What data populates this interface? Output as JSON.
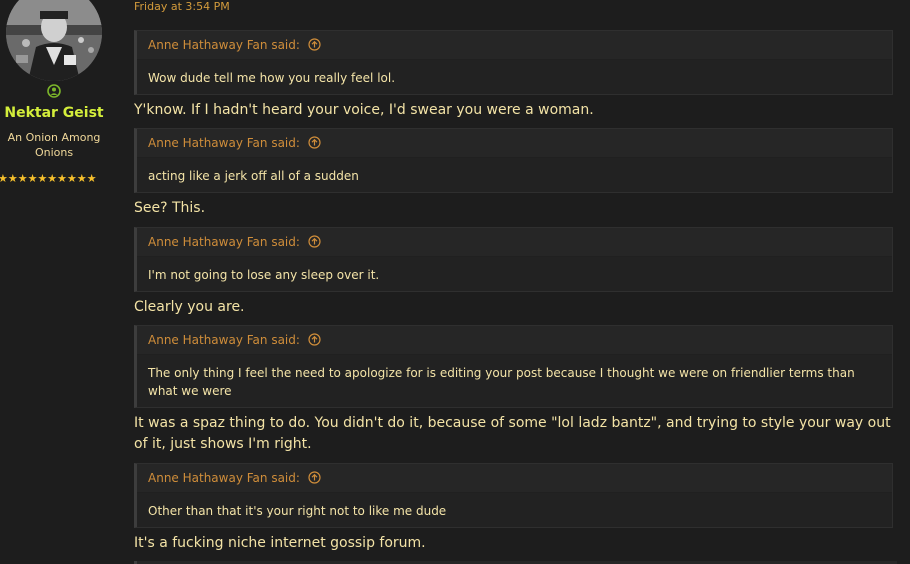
{
  "user": {
    "name": "Nektar Geist",
    "title": "An Onion Among Onions",
    "stars": "★★★★★★★★★★"
  },
  "post": {
    "timestamp": "Friday at 3:54 PM",
    "blocks": [
      {
        "quote_author": "Anne Hathaway Fan said:",
        "quote_text": "Wow dude tell me how you really feel lol.",
        "reply": "Y'know. If I hadn't heard your voice, I'd swear you were a woman."
      },
      {
        "quote_author": "Anne Hathaway Fan said:",
        "quote_text": "acting like a jerk off all of a sudden",
        "reply": "See? This."
      },
      {
        "quote_author": "Anne Hathaway Fan said:",
        "quote_text": "I'm not going to lose any sleep over it.",
        "reply": "Clearly you are."
      },
      {
        "quote_author": "Anne Hathaway Fan said:",
        "quote_text": "The only thing I feel the need to apologize for is editing your post because I thought we were on friendlier terms than what we were",
        "reply": "It was a spaz thing to do. You didn't do it, because of some \"lol ladz bantz\", and trying to style your way out of it, just shows I'm right."
      },
      {
        "quote_author": "Anne Hathaway Fan said:",
        "quote_text": "Other than that it's your right not to like me dude",
        "reply": "It's a fucking niche internet gossip forum."
      }
    ]
  },
  "colors": {
    "background": "#1d1d1d",
    "quote_background": "#262626",
    "quote_author": "#cf8d3a",
    "text": "#f3e3a6",
    "username": "#d4ee3b",
    "online": "#7bb52a",
    "stars": "#f6c02d"
  },
  "icons": {
    "online": "online-status-icon",
    "quote_link": "arrow-up-circle-icon"
  }
}
